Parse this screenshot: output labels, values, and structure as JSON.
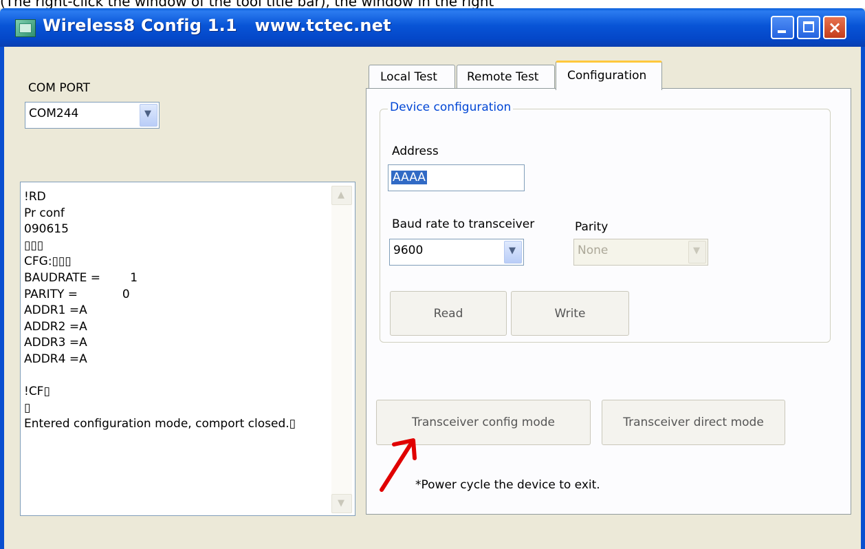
{
  "top_caption": "(The right-click the window of the tool title bar),  the window in the right",
  "window": {
    "title": "Wireless8 Config 1.1   www.tctec.net",
    "controls": {
      "minimize": "minimize",
      "maximize": "maximize",
      "close": "×"
    }
  },
  "left": {
    "com_port_label": "COM PORT",
    "com_port_value": "COM244",
    "log_lines": [
      "!RD",
      "Pr conf",
      "090615",
      "▯▯▯",
      "CFG:▯▯▯",
      "BAUDRATE =        1",
      "PARITY =            0",
      "ADDR1 =A",
      "ADDR2 =A",
      "ADDR3 =A",
      "ADDR4 =A",
      "",
      "!CF▯",
      "▯",
      "Entered configuration mode, comport closed.▯"
    ]
  },
  "tabs": [
    {
      "label": "Local Test"
    },
    {
      "label": "Remote Test"
    },
    {
      "label": "Configuration",
      "active": true
    }
  ],
  "config": {
    "group_title": "Device configuration",
    "address_label": "Address",
    "address_value": "AAAA",
    "baud_label": "Baud rate to transceiver",
    "baud_value": "9600",
    "parity_label": "Parity",
    "parity_value": "None",
    "read_button": "Read",
    "write_button": "Write",
    "config_mode_button": "Transceiver config mode",
    "direct_mode_button": "Transceiver direct mode",
    "power_note": "*Power cycle the device to exit."
  },
  "colors": {
    "titlebar": "#0854d6",
    "window_bg": "#ece9d8",
    "group_title": "#0046d5",
    "annotation_arrow": "#e00000"
  }
}
